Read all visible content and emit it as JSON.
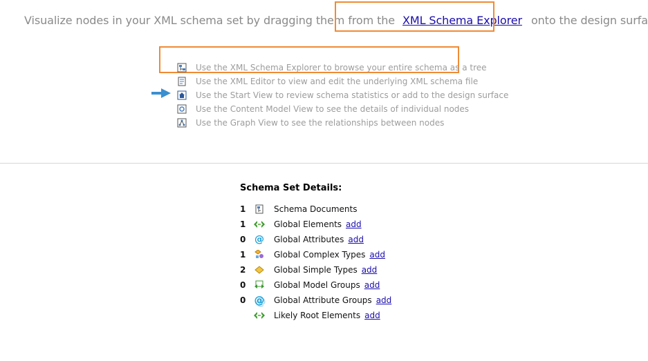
{
  "intro": {
    "before": "Visualize nodes in your XML schema set by dragging them from the",
    "link": "XML Schema Explorer",
    "after": "onto the design surface."
  },
  "tips": [
    {
      "icon": "schema-explorer-icon",
      "text": "Use the XML Schema Explorer to browse your entire schema as a tree"
    },
    {
      "icon": "xml-editor-icon",
      "text": "Use the XML Editor to view and edit the underlying XML schema file"
    },
    {
      "icon": "start-view-icon",
      "text": "Use the Start View to review schema statistics or add to the design surface"
    },
    {
      "icon": "content-model-view-icon",
      "text": "Use the Content Model View to see the details of individual nodes"
    },
    {
      "icon": "graph-view-icon",
      "text": "Use the Graph View to see the relationships between nodes"
    }
  ],
  "details": {
    "title": "Schema Set Details:",
    "rows": [
      {
        "count": "1",
        "icon": "schema-document-icon",
        "label": "Schema Documents",
        "add": ""
      },
      {
        "count": "1",
        "icon": "global-element-icon",
        "label": "Global Elements",
        "add": "add"
      },
      {
        "count": "0",
        "icon": "global-attribute-icon",
        "label": "Global Attributes",
        "add": "add"
      },
      {
        "count": "1",
        "icon": "complex-type-icon",
        "label": "Global Complex Types",
        "add": "add"
      },
      {
        "count": "2",
        "icon": "simple-type-icon",
        "label": "Global Simple Types",
        "add": "add"
      },
      {
        "count": "0",
        "icon": "model-group-icon",
        "label": "Global Model Groups",
        "add": "add"
      },
      {
        "count": "0",
        "icon": "attribute-group-icon",
        "label": "Global Attribute Groups",
        "add": "add"
      },
      {
        "count": "",
        "icon": "root-element-icon",
        "label": "Likely Root Elements",
        "add": "add"
      }
    ]
  },
  "colors": {
    "highlight": "#f08a34",
    "link": "#1a0dab",
    "tip_text": "#9c9c9c",
    "arrow": "#3a8fd0"
  }
}
